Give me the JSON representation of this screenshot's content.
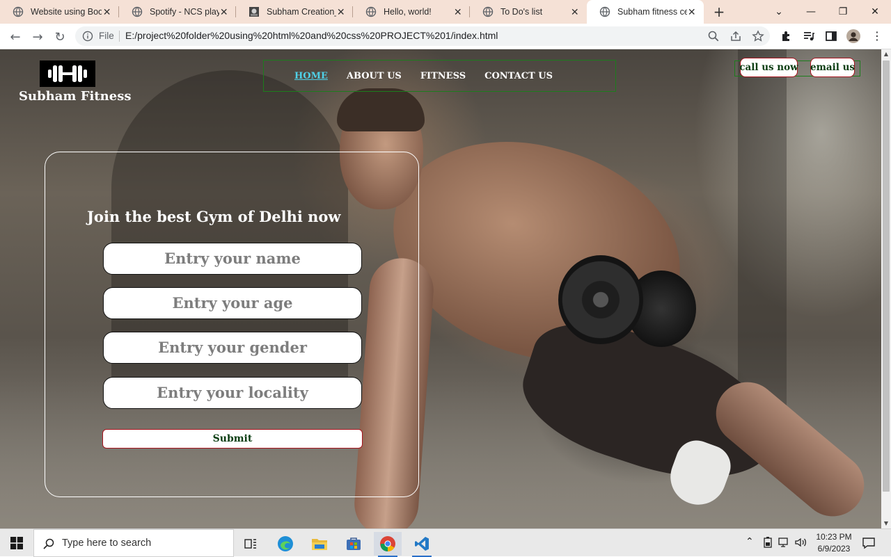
{
  "browser": {
    "tabs": [
      {
        "title": "Website using Boot",
        "active": false
      },
      {
        "title": "Spotify - NCS playir",
        "active": false
      },
      {
        "title": "Subham Creation_",
        "active": false
      },
      {
        "title": "Hello, world!",
        "active": false
      },
      {
        "title": "To Do's list",
        "active": false
      },
      {
        "title": "Subham fitness cen",
        "active": true
      }
    ],
    "address": {
      "scheme_label": "File",
      "url": "E:/project%20folder%20using%20html%20and%20css%20PROJECT%201/index.html"
    }
  },
  "site": {
    "brand": "Subham Fitness",
    "nav": [
      {
        "label": "Home",
        "active": true
      },
      {
        "label": "About Us",
        "active": false
      },
      {
        "label": "Fitness",
        "active": false
      },
      {
        "label": "Contact Us",
        "active": false
      }
    ],
    "cta": {
      "call": "call us now",
      "email": "email us"
    },
    "form": {
      "title": "Join the best Gym of Delhi now",
      "name_placeholder": "Entry your name",
      "age_placeholder": "Entry your age",
      "gender_placeholder": "Entry your gender",
      "locality_placeholder": "Entry your locality",
      "submit_label": "Submit"
    }
  },
  "taskbar": {
    "search_placeholder": "Type here to search",
    "time": "10:23 PM",
    "date": "6/9/2023"
  },
  "colors": {
    "nav_active": "#4fd1e8",
    "button_border": "#a8141e",
    "button_text": "#0b3d12",
    "nav_box_border": "#1c7d1c",
    "tab_strip": "#f5e1d6"
  }
}
